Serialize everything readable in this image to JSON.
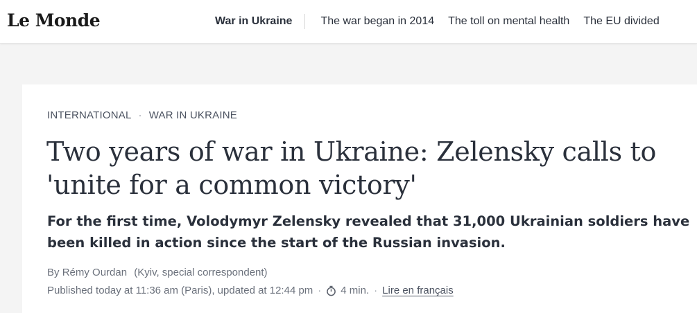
{
  "header": {
    "logo_text": "Le Monde",
    "nav": [
      {
        "label": "War in Ukraine",
        "current": true
      },
      {
        "label": "The war began in 2014"
      },
      {
        "label": "The toll on mental health"
      },
      {
        "label": "The EU divided"
      }
    ]
  },
  "article": {
    "breadcrumb": {
      "section": "INTERNATIONAL",
      "separator": "·",
      "topic": "WAR IN UKRAINE"
    },
    "headline": "Two years of war in Ukraine: Zelensky calls to 'unite for a common victory'",
    "lead": "For the first time, Volodymyr Zelensky revealed that 31,000 Ukrainian soldiers have been killed in action since the start of the Russian invasion.",
    "byline": {
      "prefix": "By",
      "author": "Rémy Ourdan",
      "role": "(Kyiv, special correspondent)"
    },
    "meta": {
      "published": "Published today at 11:36 am (Paris), updated at 12:44 pm",
      "separator": "·",
      "reading_time": "4 min.",
      "lang_link": "Lire en français"
    }
  },
  "icons": {
    "timer": "stopwatch-icon"
  },
  "colors": {
    "text": "#2a303b",
    "muted": "#6b717c",
    "background": "#f4f4f4",
    "card": "#ffffff"
  }
}
